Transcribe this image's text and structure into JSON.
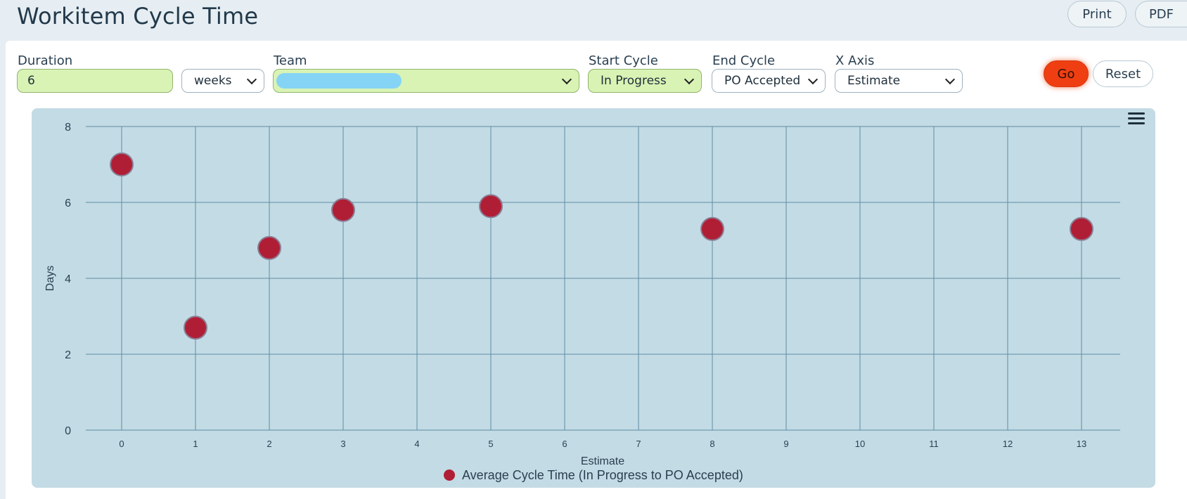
{
  "header": {
    "title": "Workitem Cycle Time",
    "print_label": "Print",
    "pdf_label": "PDF"
  },
  "filters": {
    "duration_label": "Duration",
    "duration_value": "6",
    "unit_value": "weeks",
    "team_label": "Team",
    "team_value": "",
    "start_cycle_label": "Start Cycle",
    "start_cycle_value": "In Progress",
    "end_cycle_label": "End Cycle",
    "end_cycle_value": "PO Accepted",
    "xaxis_label": "X Axis",
    "xaxis_value": "Estimate",
    "go_label": "Go",
    "reset_label": "Reset"
  },
  "colors": {
    "accent": "#ef3f12",
    "field_green": "#d9f3b5",
    "point": "#b01e36",
    "plot_bg": "#c3dbe5"
  },
  "chart_data": {
    "type": "scatter",
    "xlabel": "Estimate",
    "ylabel": "Days",
    "xlim": [
      0,
      13
    ],
    "ylim": [
      0,
      8
    ],
    "xticks": [
      "0",
      "1",
      "2",
      "3",
      "4",
      "5",
      "6",
      "7",
      "8",
      "9",
      "10",
      "11",
      "12",
      "13"
    ],
    "yticks": [
      "0",
      "2",
      "4",
      "6",
      "8"
    ],
    "grid": true,
    "legend_position": "bottom-center",
    "series": [
      {
        "name": "Average Cycle Time (In Progress to PO Accepted)",
        "color": "#b01e36",
        "points": [
          {
            "x": 0,
            "y": 7.0
          },
          {
            "x": 1,
            "y": 2.7
          },
          {
            "x": 2,
            "y": 4.8
          },
          {
            "x": 3,
            "y": 5.8
          },
          {
            "x": 5,
            "y": 5.9
          },
          {
            "x": 8,
            "y": 5.3
          },
          {
            "x": 13,
            "y": 5.3
          }
        ]
      }
    ]
  }
}
